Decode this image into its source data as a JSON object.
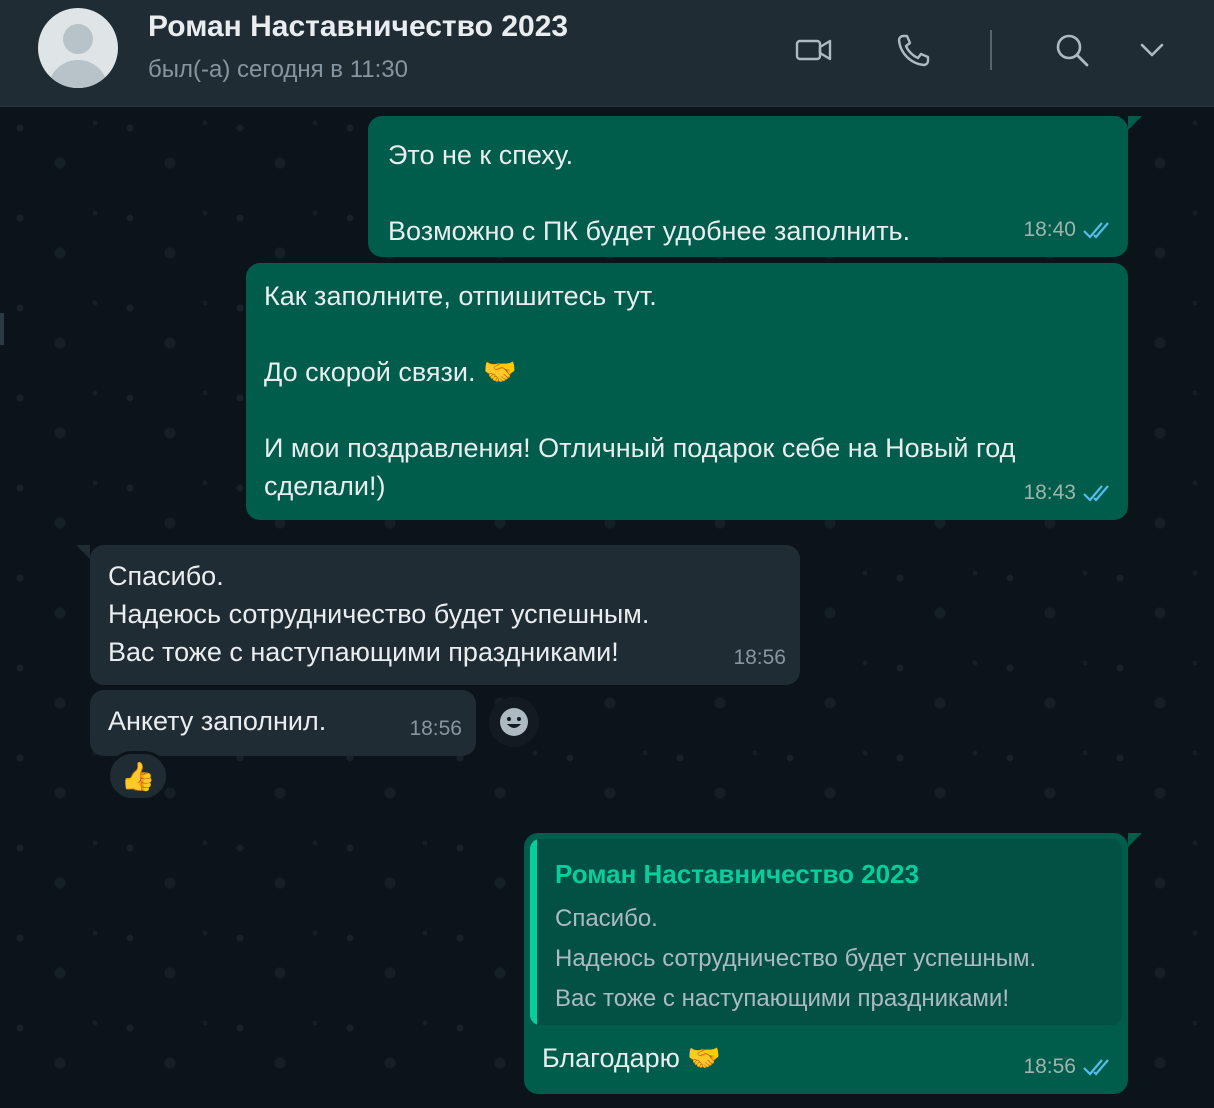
{
  "header": {
    "name": "Роман Наставничество 2023",
    "status": "был(-а) сегодня в 11:30"
  },
  "icons": {
    "video": "video-call-icon",
    "phone": "phone-icon",
    "search": "search-icon",
    "menu": "chevron-down-icon"
  },
  "colors": {
    "outgoing_bubble": "#005c4b",
    "incoming_bubble": "#202c33",
    "read_ticks": "#53bdeb",
    "accent": "#06cf9c"
  },
  "messages": [
    {
      "dir": "out",
      "text": "Это не к спеху.\n\nВозможно с ПК будет удобнее заполнить.",
      "time": "18:40",
      "read": true
    },
    {
      "dir": "out",
      "text": "Как заполните, отпишитесь тут.\n\nДо скорой связи. 🤝\n\nИ мои поздравления! Отличный подарок себе на Новый год\nсделали!)",
      "time": "18:43",
      "read": true
    },
    {
      "dir": "in",
      "text": "Спасибо.\nНадеюсь сотрудничество будет успешным.\nВас тоже с наступающими праздниками!",
      "time": "18:56"
    },
    {
      "dir": "in",
      "text": "Анкету заполнил.",
      "time": "18:56",
      "reaction": "👍"
    },
    {
      "dir": "out",
      "quote": {
        "author": "Роман Наставничество 2023",
        "text": "Спасибо.\nНадеюсь сотрудничество будет успешным.\nВас тоже с наступающими праздниками!"
      },
      "text": "Благодарю 🤝",
      "time": "18:56",
      "read": true
    }
  ]
}
